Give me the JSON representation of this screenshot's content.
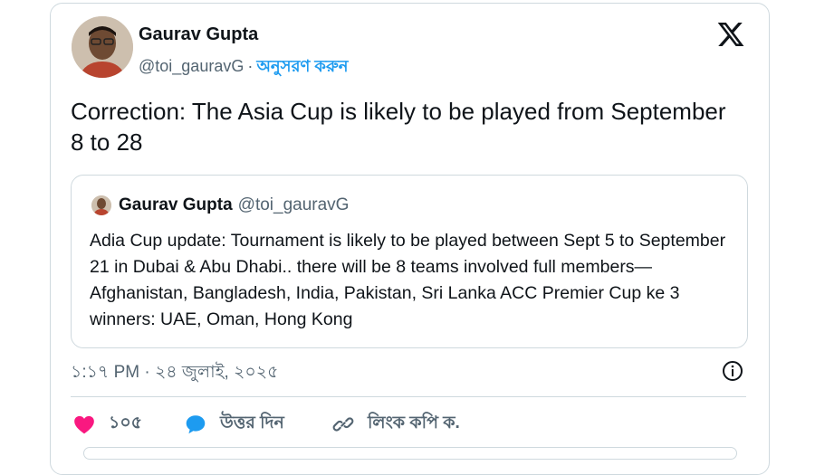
{
  "tweet": {
    "author_name": "Gaurav Gupta",
    "handle": "@toi_gauravG",
    "separator": "·",
    "follow_label": "অনুসরণ করুন",
    "text": "Correction: The Asia Cup is likely to be played from September 8 to 28",
    "timestamp": "১:১৭ PM · ২৪ জুলাই, ২০২৫",
    "likes_count": "১০৫",
    "reply_label": "উত্তর দিন",
    "copy_link_label": "লিংক কপি ক."
  },
  "quoted": {
    "author_name": "Gaurav Gupta",
    "handle": "@toi_gauravG",
    "text": "Adia Cup update: Tournament is likely to be played between Sept 5 to September 21 in Dubai & Abu Dhabi.. there will be 8 teams involved full members—Afghanistan, Bangladesh, India, Pakistan, Sri Lanka ACC Premier Cup ke 3 winners: UAE, Oman, Hong Kong"
  },
  "icons": {
    "logo": "x-logo-icon",
    "info": "info-icon",
    "like": "heart-icon",
    "reply": "reply-bubble-icon",
    "copy": "link-icon"
  },
  "colors": {
    "accent": "#1d9bf0",
    "like": "#f91880",
    "text": "#0f1419",
    "muted": "#536471",
    "border": "#cfd9de"
  }
}
